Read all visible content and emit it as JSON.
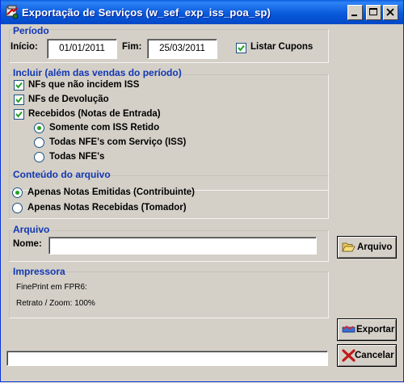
{
  "window": {
    "title": "Exportação de Serviços (w_sef_exp_iss_poa_sp)"
  },
  "periodo": {
    "title": "Período",
    "inicio_label": "Início:",
    "inicio_value": "01/01/2011",
    "fim_label": "Fim:",
    "fim_value": "25/03/2011",
    "listar_cupons_label": "Listar Cupons",
    "listar_cupons_checked": true
  },
  "incluir": {
    "title": "Incluir (além das vendas do período)",
    "items": [
      {
        "label": "NFs que não incidem ISS",
        "checked": true
      },
      {
        "label": "NFs de Devolução",
        "checked": true
      },
      {
        "label": "Recebidos (Notas de Entrada)",
        "checked": true
      }
    ],
    "radios": [
      {
        "label": "Somente com ISS Retido",
        "selected": true
      },
      {
        "label": "Todas NFE's com Serviço (ISS)",
        "selected": false
      },
      {
        "label": "Todas NFE's",
        "selected": false
      }
    ]
  },
  "conteudo": {
    "title": "Conteúdo do arquivo",
    "options": [
      {
        "label": "Apenas Notas Emitidas (Contribuinte)",
        "selected": true
      },
      {
        "label": "Apenas Notas Recebidas (Tomador)",
        "selected": false
      }
    ]
  },
  "arquivo": {
    "title": "Arquivo",
    "nome_label": "Nome:",
    "nome_value": "",
    "button_label": "Arquivo"
  },
  "impressora": {
    "title": "Impressora",
    "printer": "FinePrint em FPR6:",
    "mode": "Retrato / Zoom: 100%"
  },
  "actions": {
    "exportar": "Exportar",
    "cancelar": "Cancelar"
  },
  "status_text": ""
}
